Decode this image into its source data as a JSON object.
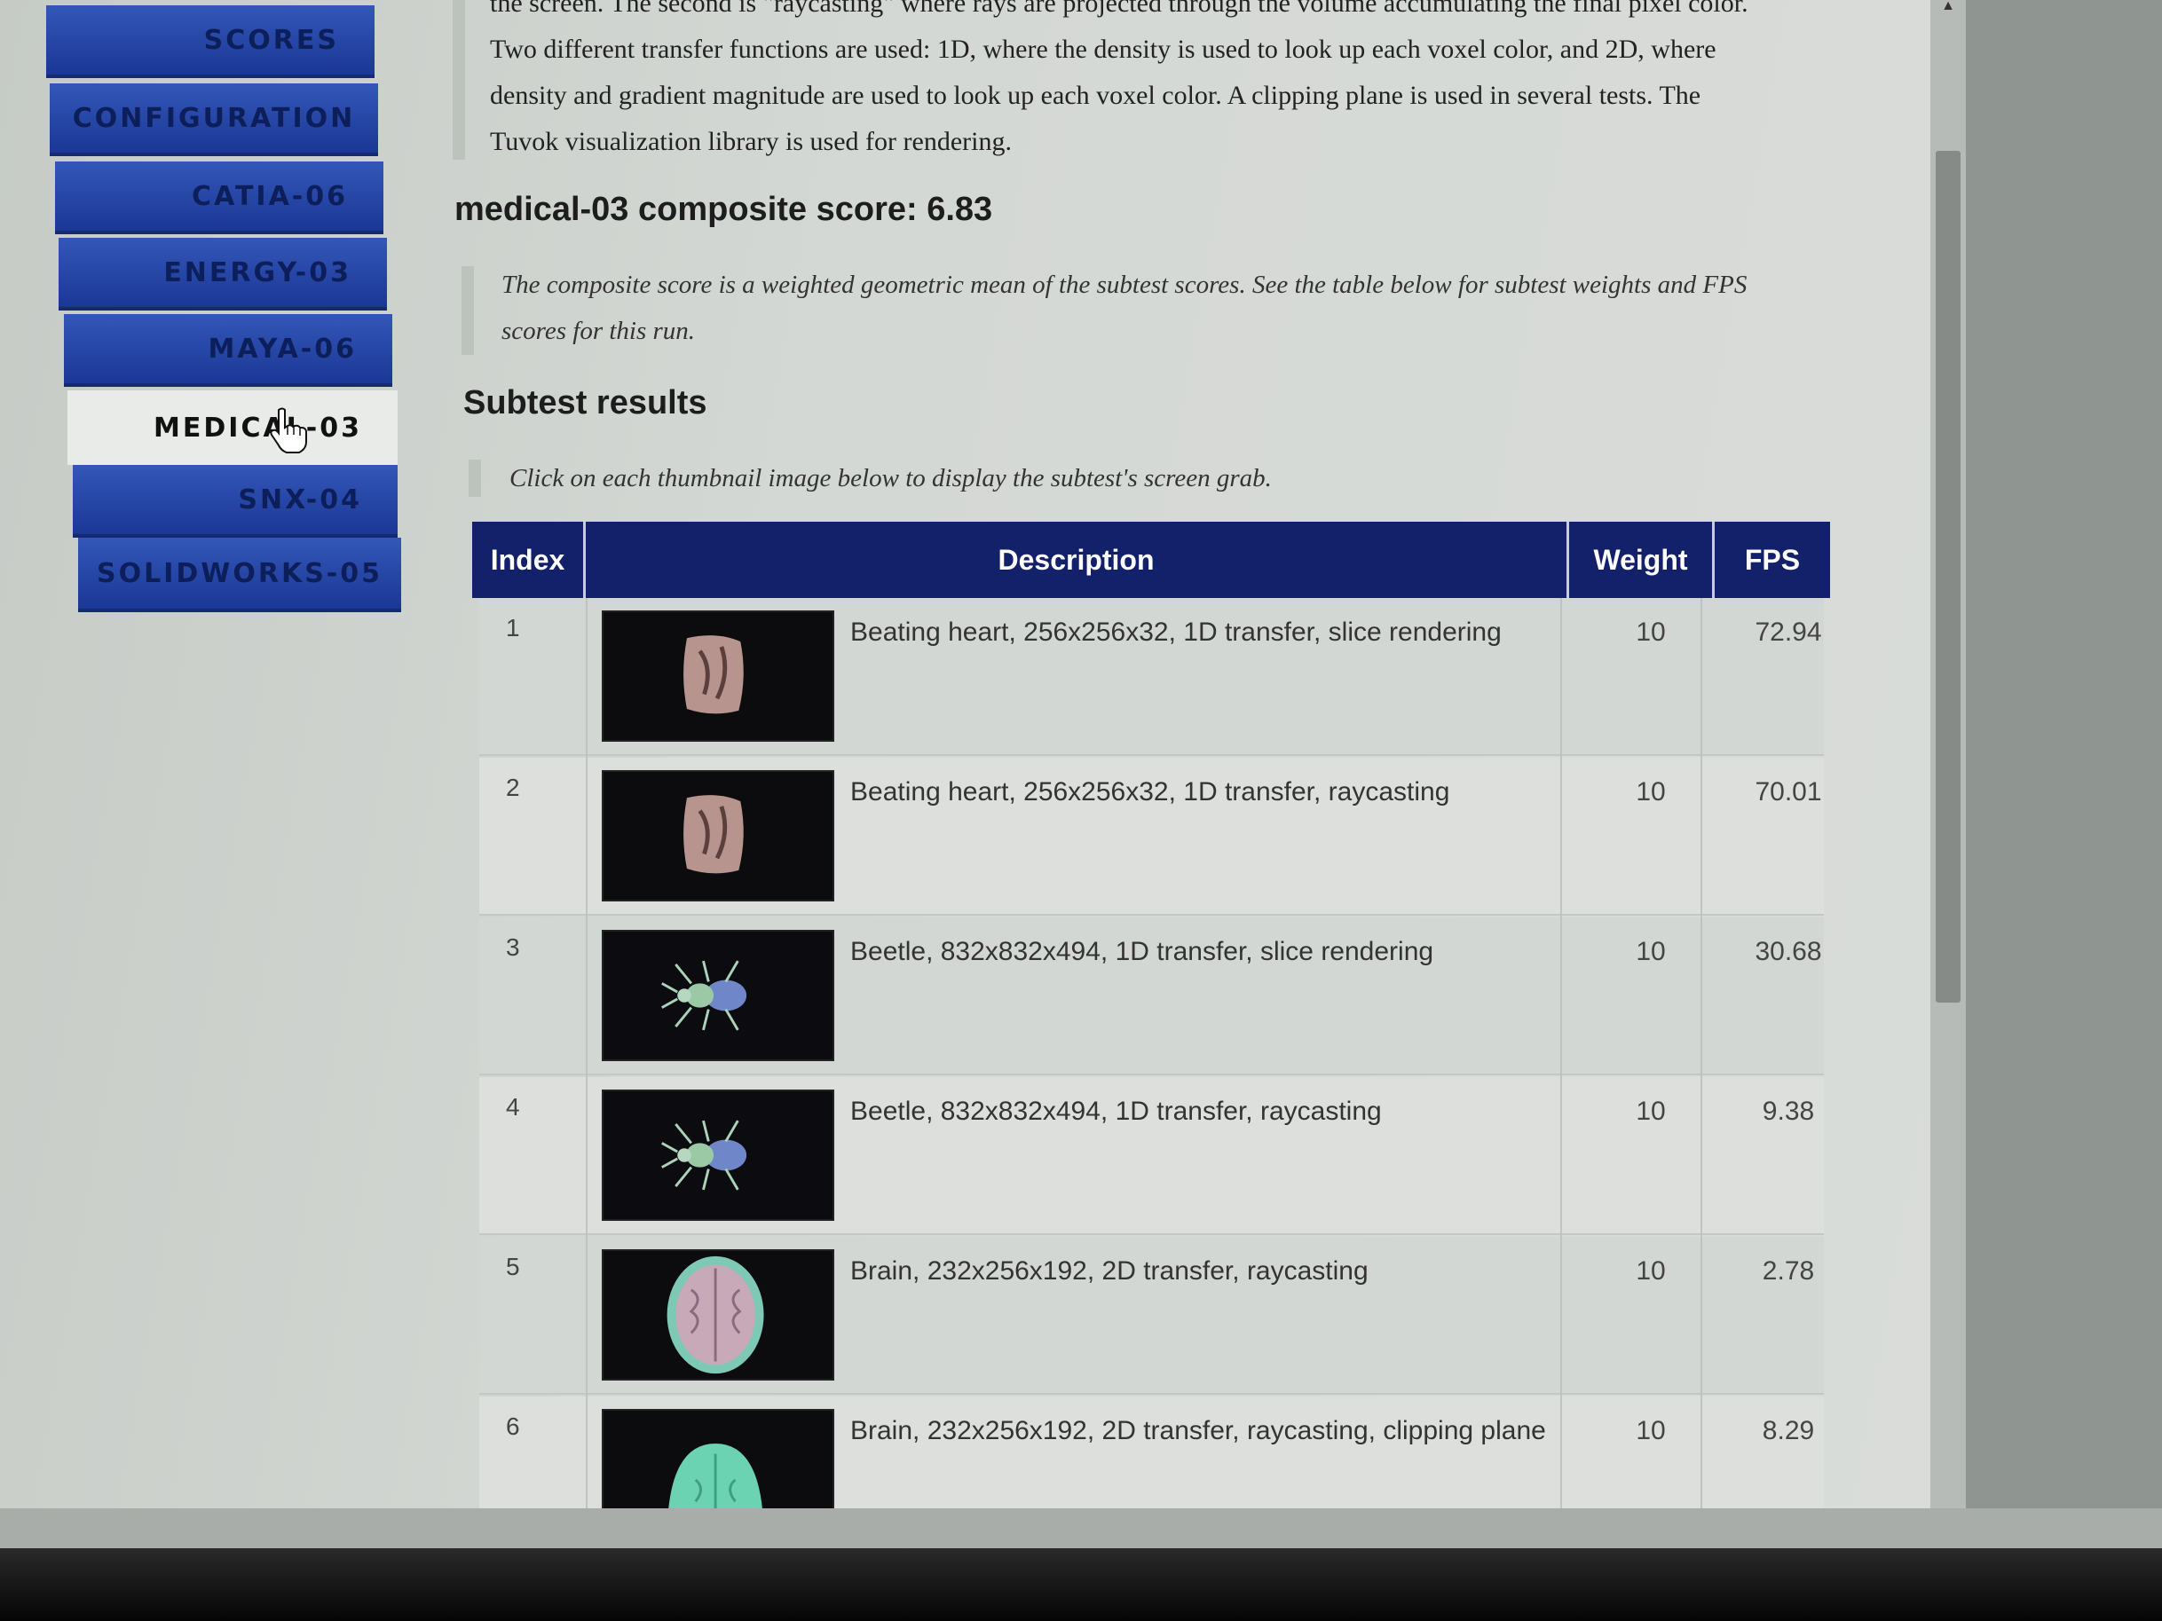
{
  "sidebar": {
    "items": [
      {
        "label": "SCORES"
      },
      {
        "label": "CONFIGURATION"
      },
      {
        "label": "CATIA-06"
      },
      {
        "label": "ENERGY-03"
      },
      {
        "label": "MAYA-06"
      },
      {
        "label": "MEDICAL-03",
        "active": true
      },
      {
        "label": "SNX-04"
      },
      {
        "label": "SOLIDWORKS-05"
      }
    ]
  },
  "intro": {
    "line0": "the screen. The second is \"raycasting\" where rays are projected through the volume accumulating the final pixel color.",
    "line1": "Two different transfer functions are used: 1D, where the density is used to look up each voxel color, and 2D, where",
    "line2": "density and gradient magnitude are used to look up each voxel color. A clipping plane is used in several tests. The",
    "line3": "Tuvok visualization library is used for rendering."
  },
  "composite": {
    "title": "medical-03 composite score: 6.83",
    "note_line1": "The composite score is a weighted geometric mean of the subtest scores. See the table below for subtest weights and FPS",
    "note_line2": "scores for this run."
  },
  "subtests": {
    "title": "Subtest results",
    "note": "Click on each thumbnail image below to display the subtest's screen grab.",
    "headers": {
      "index": "Index",
      "description": "Description",
      "weight": "Weight",
      "fps": "FPS"
    },
    "rows": [
      {
        "index": "1",
        "description": "Beating heart, 256x256x32, 1D transfer, slice rendering",
        "weight": "10",
        "fps": "72.94",
        "thumb": "heart"
      },
      {
        "index": "2",
        "description": "Beating heart, 256x256x32, 1D transfer, raycasting",
        "weight": "10",
        "fps": "70.01",
        "thumb": "heart"
      },
      {
        "index": "3",
        "description": "Beetle, 832x832x494, 1D transfer, slice rendering",
        "weight": "10",
        "fps": "30.68",
        "thumb": "beetle"
      },
      {
        "index": "4",
        "description": "Beetle, 832x832x494, 1D transfer, raycasting",
        "weight": "10",
        "fps": "9.38",
        "thumb": "beetle"
      },
      {
        "index": "5",
        "description": "Brain, 232x256x192, 2D transfer, raycasting",
        "weight": "10",
        "fps": "2.78",
        "thumb": "brain"
      },
      {
        "index": "6",
        "description": "Brain, 232x256x192, 2D transfer, raycasting, clipping plane",
        "weight": "10",
        "fps": "8.29",
        "thumb": "brain-clipped"
      }
    ]
  },
  "colors": {
    "nav_blue": "#2646a6",
    "table_header": "#13206a",
    "active_bg": "#e8ebe8"
  }
}
